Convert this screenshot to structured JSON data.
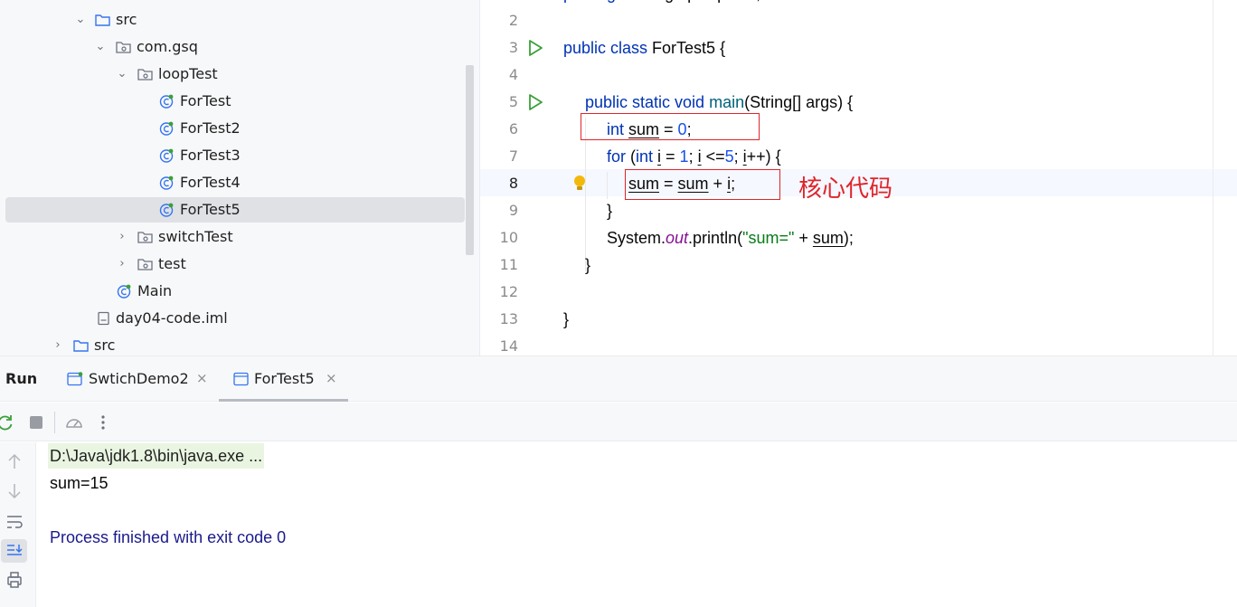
{
  "project_tree": {
    "items": [
      {
        "label": "src",
        "kind": "folder",
        "expanded": true
      },
      {
        "label": "com.gsq",
        "kind": "package",
        "expanded": true
      },
      {
        "label": "loopTest",
        "kind": "package",
        "expanded": true
      },
      {
        "label": "ForTest",
        "kind": "class"
      },
      {
        "label": "ForTest2",
        "kind": "class"
      },
      {
        "label": "ForTest3",
        "kind": "class"
      },
      {
        "label": "ForTest4",
        "kind": "class"
      },
      {
        "label": "ForTest5",
        "kind": "class",
        "selected": true
      },
      {
        "label": "switchTest",
        "kind": "package",
        "expanded": false
      },
      {
        "label": "test",
        "kind": "package",
        "expanded": false
      },
      {
        "label": "Main",
        "kind": "class"
      },
      {
        "label": "day04-code.iml",
        "kind": "file"
      },
      {
        "label": "src",
        "kind": "folder",
        "expanded": false
      }
    ]
  },
  "editor": {
    "line_numbers": [
      "2",
      "3",
      "4",
      "5",
      "6",
      "7",
      "8",
      "9",
      "10",
      "11",
      "12",
      "13",
      "14"
    ],
    "current_line": "8",
    "annotation": "核心代码",
    "code": {
      "l3_kw": "public class ",
      "l3_rest": "ForTest5 {",
      "l5_kw": "public static void ",
      "l5_fn": "main",
      "l5_rest": "(String[] args) {",
      "l6_kw": "int ",
      "l6_var": "sum",
      "l6_eq": " = ",
      "l6_num": "0",
      "l6_end": ";",
      "l7_for": "for ",
      "l7_p1": "(",
      "l7_int": "int ",
      "l7_i": "i",
      "l7_eq": " = ",
      "l7_one": "1",
      "l7_semi": "; ",
      "l7_i2": "i",
      "l7_le": " <=",
      "l7_five": "5",
      "l7_semi2": "; ",
      "l7_i3": "i",
      "l7_end": "++) {",
      "l8_sum": "sum",
      "l8_eq": " = ",
      "l8_sum2": "sum",
      "l8_plus": " + ",
      "l8_i": "i",
      "l8_end": ";",
      "l9": "}",
      "l10_sys": "System.",
      "l10_out": "out",
      "l10_p": ".println(",
      "l10_str": "\"sum=\"",
      "l10_plus": " + ",
      "l10_sum": "sum",
      "l10_end": ");",
      "l11": "}",
      "l13": "}"
    }
  },
  "run_panel": {
    "title": "Run",
    "tabs": [
      {
        "label": "SwtichDemo2",
        "close": "×"
      },
      {
        "label": "ForTest5",
        "close": "×",
        "active": true
      }
    ],
    "console": {
      "command": "D:\\Java\\jdk1.8\\bin\\java.exe ...",
      "output": "sum=15",
      "exit": "Process finished with exit code 0"
    }
  },
  "colors": {
    "keyword": "#0033b3",
    "number": "#1750eb",
    "string": "#067d17",
    "annotation": "#e0242a",
    "run_icon": "#3aa03a"
  }
}
